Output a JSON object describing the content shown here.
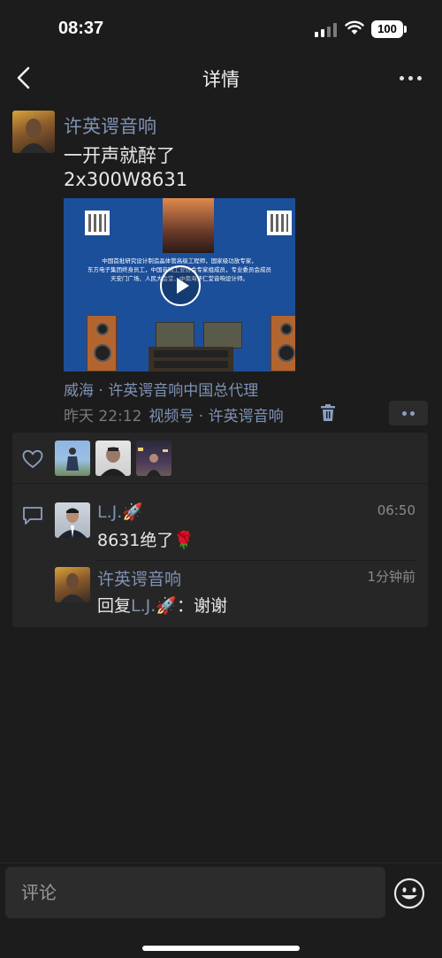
{
  "status_bar": {
    "time": "08:37",
    "battery": "100"
  },
  "nav": {
    "title": "详情",
    "back_icon": "chevron-left-icon",
    "more_icon": "more-dots-icon"
  },
  "post": {
    "author": "许英谔音响",
    "lines": [
      "一开声就醉了",
      "2x300W8631"
    ],
    "video": {
      "caption_lines": [
        "中国首批研究设计制造晶体管高级工程师，国家级功放专家，",
        "东方电子集团终身员工，中国音响工业协会专家组成员，专业委员会成员",
        "天安门广场、人民大会堂、中南海怀仁堂音响设计师。"
      ]
    },
    "location": "威海 · 许英谔音响中国总代理",
    "time": "昨天 22:12",
    "source": "视频号 · 许英谔音响"
  },
  "likes": {
    "icon": "heart-icon",
    "count": 3
  },
  "comments": [
    {
      "name": "L.J.🚀",
      "text": "8631绝了🌹",
      "time": "06:50"
    },
    {
      "name": "许英谔音响",
      "reply_prefix": "回复",
      "reply_to": "L.J.🚀",
      "reply_sep": "：",
      "text": "谢谢",
      "time": "1分钟前"
    }
  ],
  "input": {
    "placeholder": "评论",
    "emoji_icon": "emoji-smile-icon"
  },
  "colors": {
    "background": "#1c1c1c",
    "panel": "#262626",
    "link": "#7f92b4"
  }
}
